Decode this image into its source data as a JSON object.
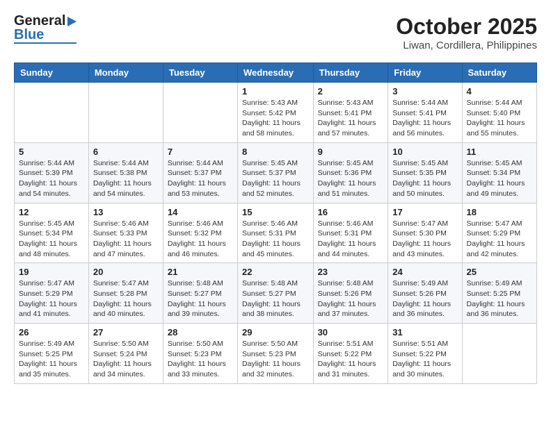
{
  "header": {
    "logo_general": "General",
    "logo_blue": "Blue",
    "title": "October 2025",
    "subtitle": "Liwan, Cordillera, Philippines"
  },
  "calendar": {
    "days_of_week": [
      "Sunday",
      "Monday",
      "Tuesday",
      "Wednesday",
      "Thursday",
      "Friday",
      "Saturday"
    ],
    "weeks": [
      [
        {
          "day": "",
          "info": ""
        },
        {
          "day": "",
          "info": ""
        },
        {
          "day": "",
          "info": ""
        },
        {
          "day": "1",
          "info": "Sunrise: 5:43 AM\nSunset: 5:42 PM\nDaylight: 11 hours\nand 58 minutes."
        },
        {
          "day": "2",
          "info": "Sunrise: 5:43 AM\nSunset: 5:41 PM\nDaylight: 11 hours\nand 57 minutes."
        },
        {
          "day": "3",
          "info": "Sunrise: 5:44 AM\nSunset: 5:41 PM\nDaylight: 11 hours\nand 56 minutes."
        },
        {
          "day": "4",
          "info": "Sunrise: 5:44 AM\nSunset: 5:40 PM\nDaylight: 11 hours\nand 55 minutes."
        }
      ],
      [
        {
          "day": "5",
          "info": "Sunrise: 5:44 AM\nSunset: 5:39 PM\nDaylight: 11 hours\nand 54 minutes."
        },
        {
          "day": "6",
          "info": "Sunrise: 5:44 AM\nSunset: 5:38 PM\nDaylight: 11 hours\nand 54 minutes."
        },
        {
          "day": "7",
          "info": "Sunrise: 5:44 AM\nSunset: 5:37 PM\nDaylight: 11 hours\nand 53 minutes."
        },
        {
          "day": "8",
          "info": "Sunrise: 5:45 AM\nSunset: 5:37 PM\nDaylight: 11 hours\nand 52 minutes."
        },
        {
          "day": "9",
          "info": "Sunrise: 5:45 AM\nSunset: 5:36 PM\nDaylight: 11 hours\nand 51 minutes."
        },
        {
          "day": "10",
          "info": "Sunrise: 5:45 AM\nSunset: 5:35 PM\nDaylight: 11 hours\nand 50 minutes."
        },
        {
          "day": "11",
          "info": "Sunrise: 5:45 AM\nSunset: 5:34 PM\nDaylight: 11 hours\nand 49 minutes."
        }
      ],
      [
        {
          "day": "12",
          "info": "Sunrise: 5:45 AM\nSunset: 5:34 PM\nDaylight: 11 hours\nand 48 minutes."
        },
        {
          "day": "13",
          "info": "Sunrise: 5:46 AM\nSunset: 5:33 PM\nDaylight: 11 hours\nand 47 minutes."
        },
        {
          "day": "14",
          "info": "Sunrise: 5:46 AM\nSunset: 5:32 PM\nDaylight: 11 hours\nand 46 minutes."
        },
        {
          "day": "15",
          "info": "Sunrise: 5:46 AM\nSunset: 5:31 PM\nDaylight: 11 hours\nand 45 minutes."
        },
        {
          "day": "16",
          "info": "Sunrise: 5:46 AM\nSunset: 5:31 PM\nDaylight: 11 hours\nand 44 minutes."
        },
        {
          "day": "17",
          "info": "Sunrise: 5:47 AM\nSunset: 5:30 PM\nDaylight: 11 hours\nand 43 minutes."
        },
        {
          "day": "18",
          "info": "Sunrise: 5:47 AM\nSunset: 5:29 PM\nDaylight: 11 hours\nand 42 minutes."
        }
      ],
      [
        {
          "day": "19",
          "info": "Sunrise: 5:47 AM\nSunset: 5:29 PM\nDaylight: 11 hours\nand 41 minutes."
        },
        {
          "day": "20",
          "info": "Sunrise: 5:47 AM\nSunset: 5:28 PM\nDaylight: 11 hours\nand 40 minutes."
        },
        {
          "day": "21",
          "info": "Sunrise: 5:48 AM\nSunset: 5:27 PM\nDaylight: 11 hours\nand 39 minutes."
        },
        {
          "day": "22",
          "info": "Sunrise: 5:48 AM\nSunset: 5:27 PM\nDaylight: 11 hours\nand 38 minutes."
        },
        {
          "day": "23",
          "info": "Sunrise: 5:48 AM\nSunset: 5:26 PM\nDaylight: 11 hours\nand 37 minutes."
        },
        {
          "day": "24",
          "info": "Sunrise: 5:49 AM\nSunset: 5:26 PM\nDaylight: 11 hours\nand 36 minutes."
        },
        {
          "day": "25",
          "info": "Sunrise: 5:49 AM\nSunset: 5:25 PM\nDaylight: 11 hours\nand 36 minutes."
        }
      ],
      [
        {
          "day": "26",
          "info": "Sunrise: 5:49 AM\nSunset: 5:25 PM\nDaylight: 11 hours\nand 35 minutes."
        },
        {
          "day": "27",
          "info": "Sunrise: 5:50 AM\nSunset: 5:24 PM\nDaylight: 11 hours\nand 34 minutes."
        },
        {
          "day": "28",
          "info": "Sunrise: 5:50 AM\nSunset: 5:23 PM\nDaylight: 11 hours\nand 33 minutes."
        },
        {
          "day": "29",
          "info": "Sunrise: 5:50 AM\nSunset: 5:23 PM\nDaylight: 11 hours\nand 32 minutes."
        },
        {
          "day": "30",
          "info": "Sunrise: 5:51 AM\nSunset: 5:22 PM\nDaylight: 11 hours\nand 31 minutes."
        },
        {
          "day": "31",
          "info": "Sunrise: 5:51 AM\nSunset: 5:22 PM\nDaylight: 11 hours\nand 30 minutes."
        },
        {
          "day": "",
          "info": ""
        }
      ]
    ]
  }
}
